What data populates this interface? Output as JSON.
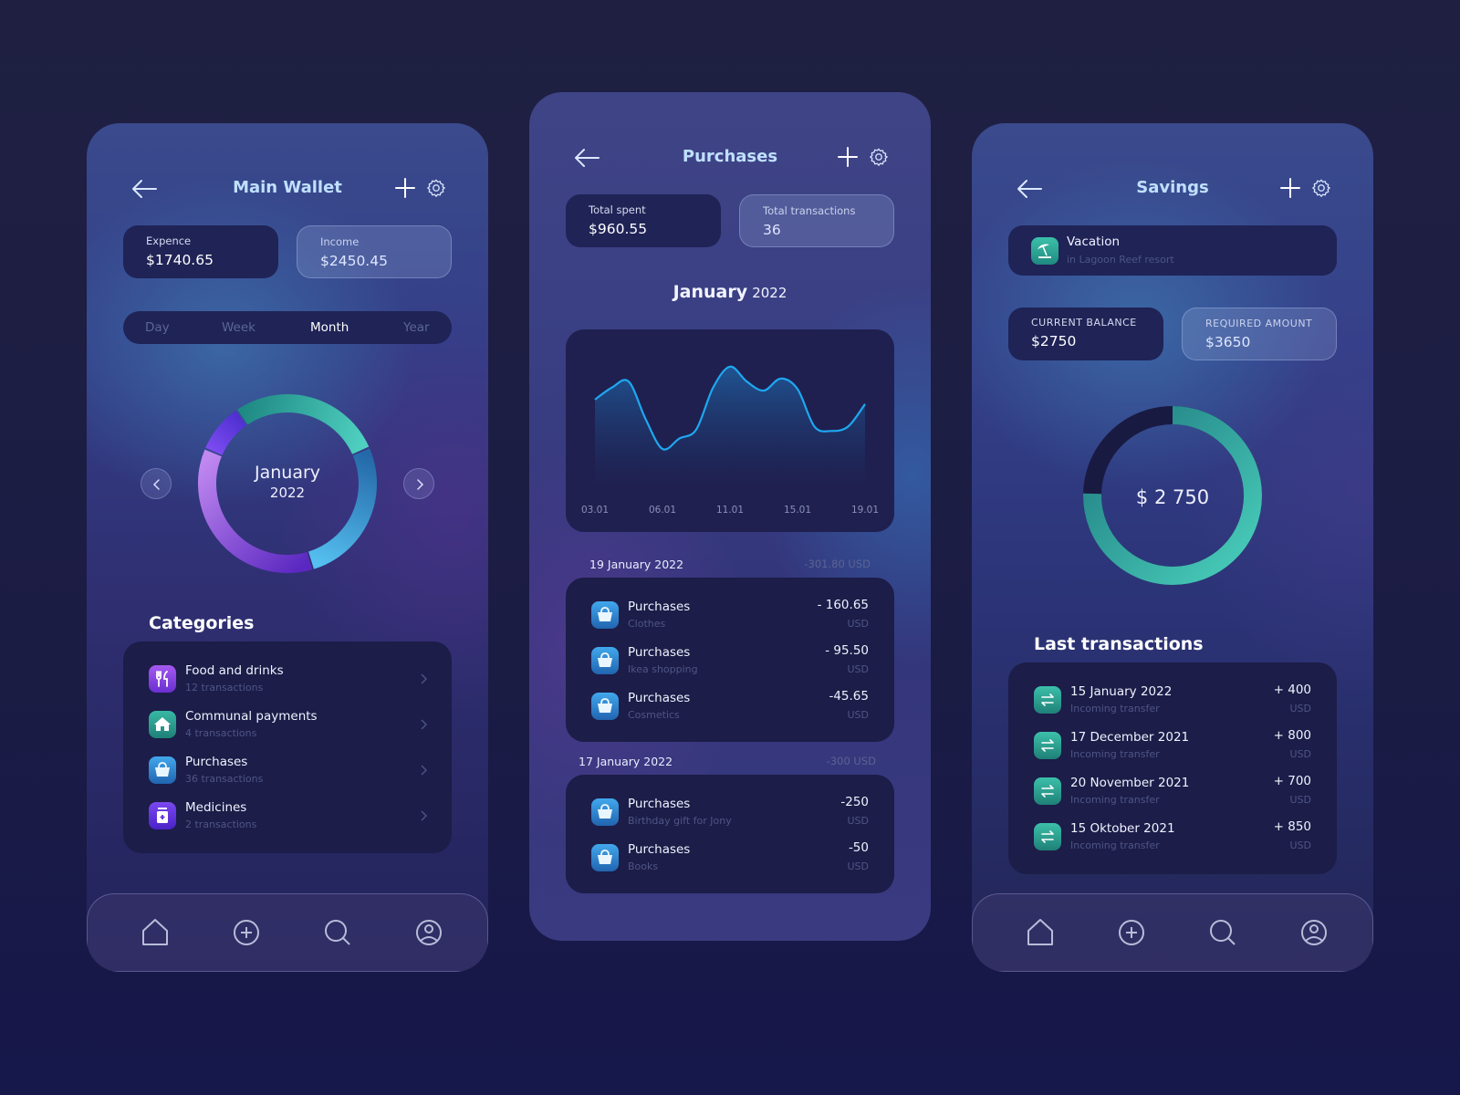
{
  "wallet": {
    "title": "Main Wallet",
    "back_icon": "arrow-left-icon",
    "add_icon": "plus-icon",
    "settings_icon": "gear-icon",
    "expense": {
      "label": "Expence",
      "value": "$1740.65"
    },
    "income": {
      "label": "Income",
      "value": "$2450.45"
    },
    "periods": [
      {
        "label": "Day",
        "active": false
      },
      {
        "label": "Week",
        "active": false
      },
      {
        "label": "Month",
        "active": true
      },
      {
        "label": "Year",
        "active": false
      }
    ],
    "donut": {
      "month": "January",
      "year": "2022",
      "segments": [
        {
          "name": "Food and drinks",
          "share": 0.09,
          "colors": [
            "#7b4bf0",
            "#4f2fd0"
          ]
        },
        {
          "name": "Communal payments",
          "share": 0.28,
          "colors": [
            "#1f8a84",
            "#4fd0c0"
          ]
        },
        {
          "name": "Purchases",
          "share": 0.27,
          "colors": [
            "#2468a8",
            "#55c0f0"
          ]
        },
        {
          "name": "Medicines",
          "share": 0.36,
          "colors": [
            "#5a28c0",
            "#c088f0"
          ]
        }
      ],
      "prev_icon": "chevron-left-icon",
      "next_icon": "chevron-right-icon"
    },
    "categories_title": "Categories",
    "categories": [
      {
        "name": "Food and drinks",
        "count": "12 transactions",
        "icon": "cutlery-icon",
        "color": "#8a45e0"
      },
      {
        "name": "Communal payments",
        "count": "4 transactions",
        "icon": "house-icon",
        "color": "#25a092"
      },
      {
        "name": "Purchases",
        "count": "36 transactions",
        "icon": "shopping-basket-icon",
        "color": "#2f8fd6"
      },
      {
        "name": "Medicines",
        "count": "2 transactions",
        "icon": "medicine-jar-icon",
        "color": "#6a34e0"
      }
    ]
  },
  "purchases": {
    "title": "Purchases",
    "total_spent": {
      "label": "Total spent",
      "value": "$960.55"
    },
    "total_transactions": {
      "label": "Total transactions",
      "value": "36"
    },
    "month": "January",
    "year": "2022",
    "groups": [
      {
        "date": "19 January 2022",
        "total": "-301.80 USD",
        "items": [
          {
            "title": "Purchases",
            "note": "Clothes",
            "amount": "- 160.65",
            "currency": "USD"
          },
          {
            "title": "Purchases",
            "note": "Ikea shopping",
            "amount": "- 95.50",
            "currency": "USD"
          },
          {
            "title": "Purchases",
            "note": "Cosmetics",
            "amount": "-45.65",
            "currency": "USD"
          }
        ]
      },
      {
        "date": "17 January 2022",
        "total": "-300 USD",
        "items": [
          {
            "title": "Purchases",
            "note": "Birthday gift for Jony",
            "amount": "-250",
            "currency": "USD"
          },
          {
            "title": "Purchases",
            "note": "Books",
            "amount": "-50",
            "currency": "USD"
          }
        ]
      }
    ]
  },
  "chart_data": {
    "type": "area",
    "title": "January 2022",
    "xlabel": "",
    "ylabel": "",
    "x_ticks": [
      "03.01",
      "06.01",
      "11.01",
      "15.01",
      "19.01"
    ],
    "x": [
      3,
      4,
      5,
      6,
      7,
      8,
      9,
      10,
      11,
      12,
      13,
      14,
      15,
      16,
      17,
      18,
      19
    ],
    "series": [
      {
        "name": "Spending",
        "color": "#1ea8f0",
        "values": [
          58,
          66,
          70,
          45,
          25,
          32,
          38,
          66,
          80,
          70,
          64,
          72,
          65,
          40,
          37,
          40,
          55
        ]
      }
    ],
    "ylim": [
      0,
      100
    ],
    "grid": false,
    "legend": "none"
  },
  "savings": {
    "title": "Savings",
    "goal": {
      "title": "Vacation",
      "subtitle": "in Lagoon Reef resort",
      "icon": "beach-umbrella-icon"
    },
    "current_balance": {
      "label": "CURRENT BALANCE",
      "value": "$2750"
    },
    "required_amount": {
      "label": "REQUIRED AMOUNT",
      "value": "$3650"
    },
    "progress": {
      "current": 2750,
      "required": 3650,
      "label": "$ 2 750"
    },
    "last_transactions_title": "Last transactions",
    "transactions": [
      {
        "date": "15 January 2022",
        "type": "Incoming transfer",
        "amount": "+ 400",
        "currency": "USD"
      },
      {
        "date": "17 December 2021",
        "type": "Incoming transfer",
        "amount": "+ 800",
        "currency": "USD"
      },
      {
        "date": "20 November 2021",
        "type": "Incoming transfer",
        "amount": "+ 700",
        "currency": "USD"
      },
      {
        "date": "15 Oktober 2021",
        "type": "Incoming transfer",
        "amount": "+ 850",
        "currency": "USD"
      }
    ]
  },
  "tabbar": [
    {
      "name": "home",
      "icon": "home-icon"
    },
    {
      "name": "add",
      "icon": "plus-circle-icon"
    },
    {
      "name": "search",
      "icon": "search-icon"
    },
    {
      "name": "profile",
      "icon": "user-icon"
    }
  ]
}
